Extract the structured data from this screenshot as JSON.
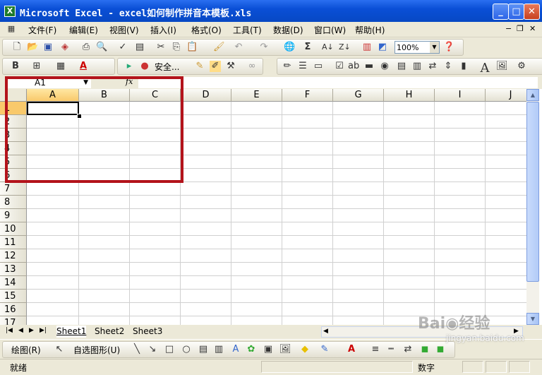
{
  "window": {
    "title": "Microsoft Excel - excel如何制作拼音本模板.xls",
    "app_icon": "X",
    "buttons": [
      "_",
      "□",
      "✕"
    ]
  },
  "menu": [
    "文件(F)",
    "编辑(E)",
    "视图(V)",
    "插入(I)",
    "格式(O)",
    "工具(T)",
    "数据(D)",
    "窗口(W)",
    "帮助(H)"
  ],
  "standard_toolbar": {
    "zoom": "100%"
  },
  "format_toolbar": {
    "bold": "B",
    "security_label": "安全..."
  },
  "formula_bar": {
    "name_box": "A1",
    "fx": "fx",
    "formula": ""
  },
  "grid": {
    "columns": [
      "A",
      "B",
      "C",
      "D",
      "E",
      "F",
      "G",
      "H",
      "I",
      "J"
    ],
    "rows": [
      "1",
      "2",
      "3",
      "4",
      "5",
      "6",
      "7",
      "8",
      "9",
      "10",
      "11",
      "12",
      "13",
      "14",
      "15",
      "16",
      "17"
    ],
    "active_cell": "A1",
    "highlight_color": "#b3131b"
  },
  "sheets": {
    "tabs": [
      "Sheet1",
      "Sheet2",
      "Sheet3"
    ],
    "active": "Sheet1"
  },
  "drawing_toolbar": {
    "draw_label": "绘图(R)",
    "autoshapes_label": "自选图形(U)"
  },
  "status": {
    "left": "就绪",
    "mode": "数字"
  },
  "watermark": {
    "brand": "Bai◉经验",
    "url": "jingyan.baidu.com"
  }
}
